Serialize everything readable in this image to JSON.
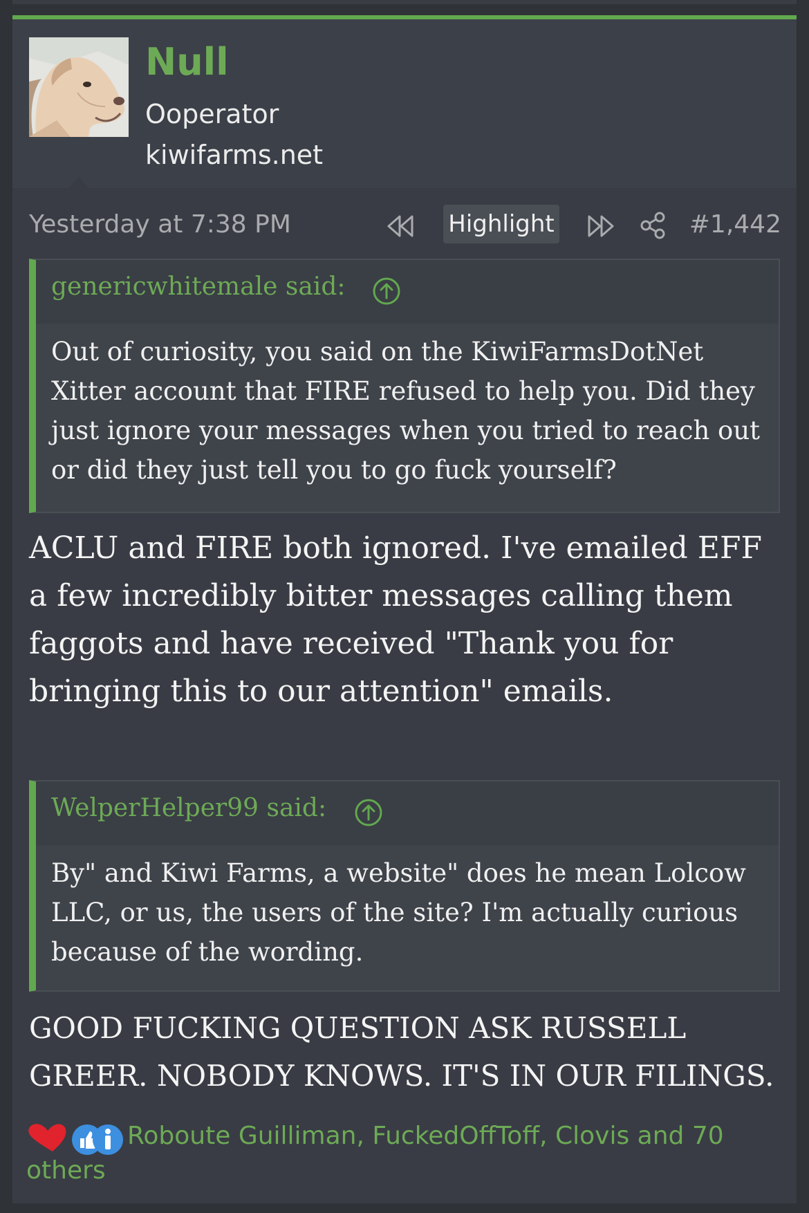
{
  "post": {
    "username": "Null",
    "user_title": "Ooperator",
    "user_banner": "kiwifarms.net",
    "timestamp": "Yesterday at 7:38 PM",
    "highlight_label": "Highlight",
    "post_number": "#1,442",
    "accent_color": "#62a84f",
    "quotes": [
      {
        "author": "genericwhitemale said:",
        "text": "Out of curiosity, you said on the KiwiFarmsDotNet Xitter account that FIRE refused to help you. Did they just ignore your messages when you tried to reach out or did they just tell you to go fuck yourself?"
      },
      {
        "author": "WelperHelper99 said:",
        "text": "By\" and Kiwi Farms, a website\" does he mean Lolcow LLC, or us, the users of the site? I'm actually curious because of the wording."
      }
    ],
    "replies": [
      "ACLU and FIRE both ignored. I've emailed EFF a few incredibly bitter messages calling them faggots and have received \"Thank you for bringing this to our attention\" emails.",
      "GOOD FUCKING QUESTION ASK RUSSELL GREER. NOBODY KNOWS. IT'S IN OUR FILINGS."
    ],
    "reactions": {
      "icons": [
        "heart-icon",
        "thumbs-up-icon",
        "info-icon"
      ],
      "users_text": "Roboute Guilliman, FuckedOffToff, Clovis and 70 others"
    }
  }
}
